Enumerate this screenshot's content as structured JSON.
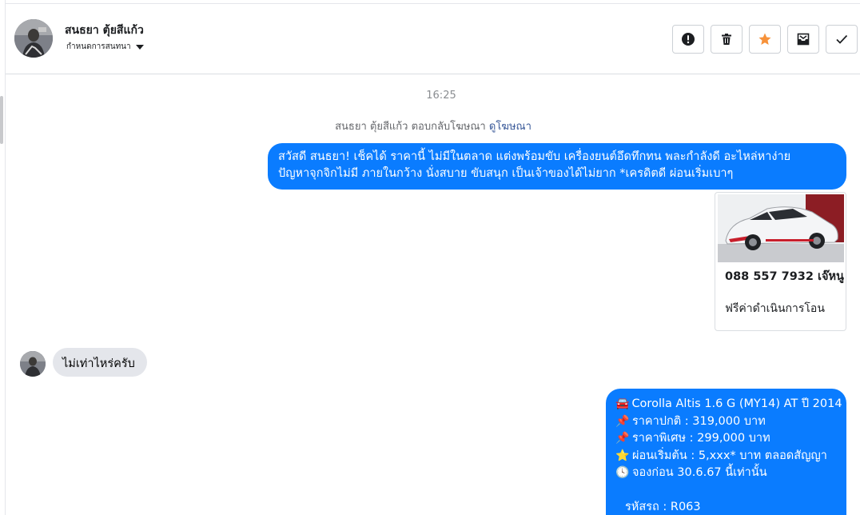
{
  "header": {
    "contact_name": "สนธยา ตุ้ยสีแก้ว",
    "label_selector": "กำหนดการสนทนา"
  },
  "actions": [
    {
      "name": "report",
      "icon": "alert-icon"
    },
    {
      "name": "delete",
      "icon": "trash-icon"
    },
    {
      "name": "star",
      "icon": "star-icon",
      "color": "#f7923a"
    },
    {
      "name": "mark-unread",
      "icon": "envelope-icon"
    },
    {
      "name": "done",
      "icon": "check-icon"
    }
  ],
  "conversation": {
    "timestamp": "16:25",
    "ad_reply_text": "สนธยา ตุ้ยสีแก้ว ตอบกลับโฆษณา",
    "ad_link": "ดูโฆษณา",
    "outgoing_1": {
      "line1": "สวัสดี สนธยา! เช็คได้ ราคานี้ ไม่มีในตลาด แต่งพร้อมขับ เครื่องยนต์อึดทึกทน พละกำลังดี อะไหล่หาง่าย",
      "line2": "ปัญหาจุกจิกไม่มี ภายในกว้าง นั่งสบาย ขับสนุก เป็นเจ้าของได้ไม่ยาก *เครดิตดี ผ่อนเริ่มเบาๆ"
    },
    "ad_card": {
      "title": "088 557 7932 เจ๊หนู",
      "subtitle": "ฟรีค่าดำเนินการโอน"
    },
    "incoming_1": "ไม่เท่าไหร่ครับ",
    "outgoing_2": {
      "lines": [
        {
          "icon": "🚘",
          "text": "Corolla Altis 1.6 G (MY14) AT ปี 2014"
        },
        {
          "icon": "📌",
          "text": "ราคาปกติ : 319,000 บาท"
        },
        {
          "icon": "📌",
          "text": "ราคาพิเศษ : 299,000 บาท"
        },
        {
          "icon": "⭐",
          "text": "ผ่อนเริ่มต้น : 5,xxx* บาท ตลอดสัญญา"
        },
        {
          "icon": "🕓",
          "text": "จองก่อน 30.6.67 นี้เท่านั้น"
        }
      ],
      "code": "รหัสรถ : R063"
    }
  },
  "colors": {
    "outgoing_bubble": "#0a7cff",
    "incoming_bubble": "#e4e6eb",
    "star": "#f7923a",
    "link": "#385898"
  }
}
